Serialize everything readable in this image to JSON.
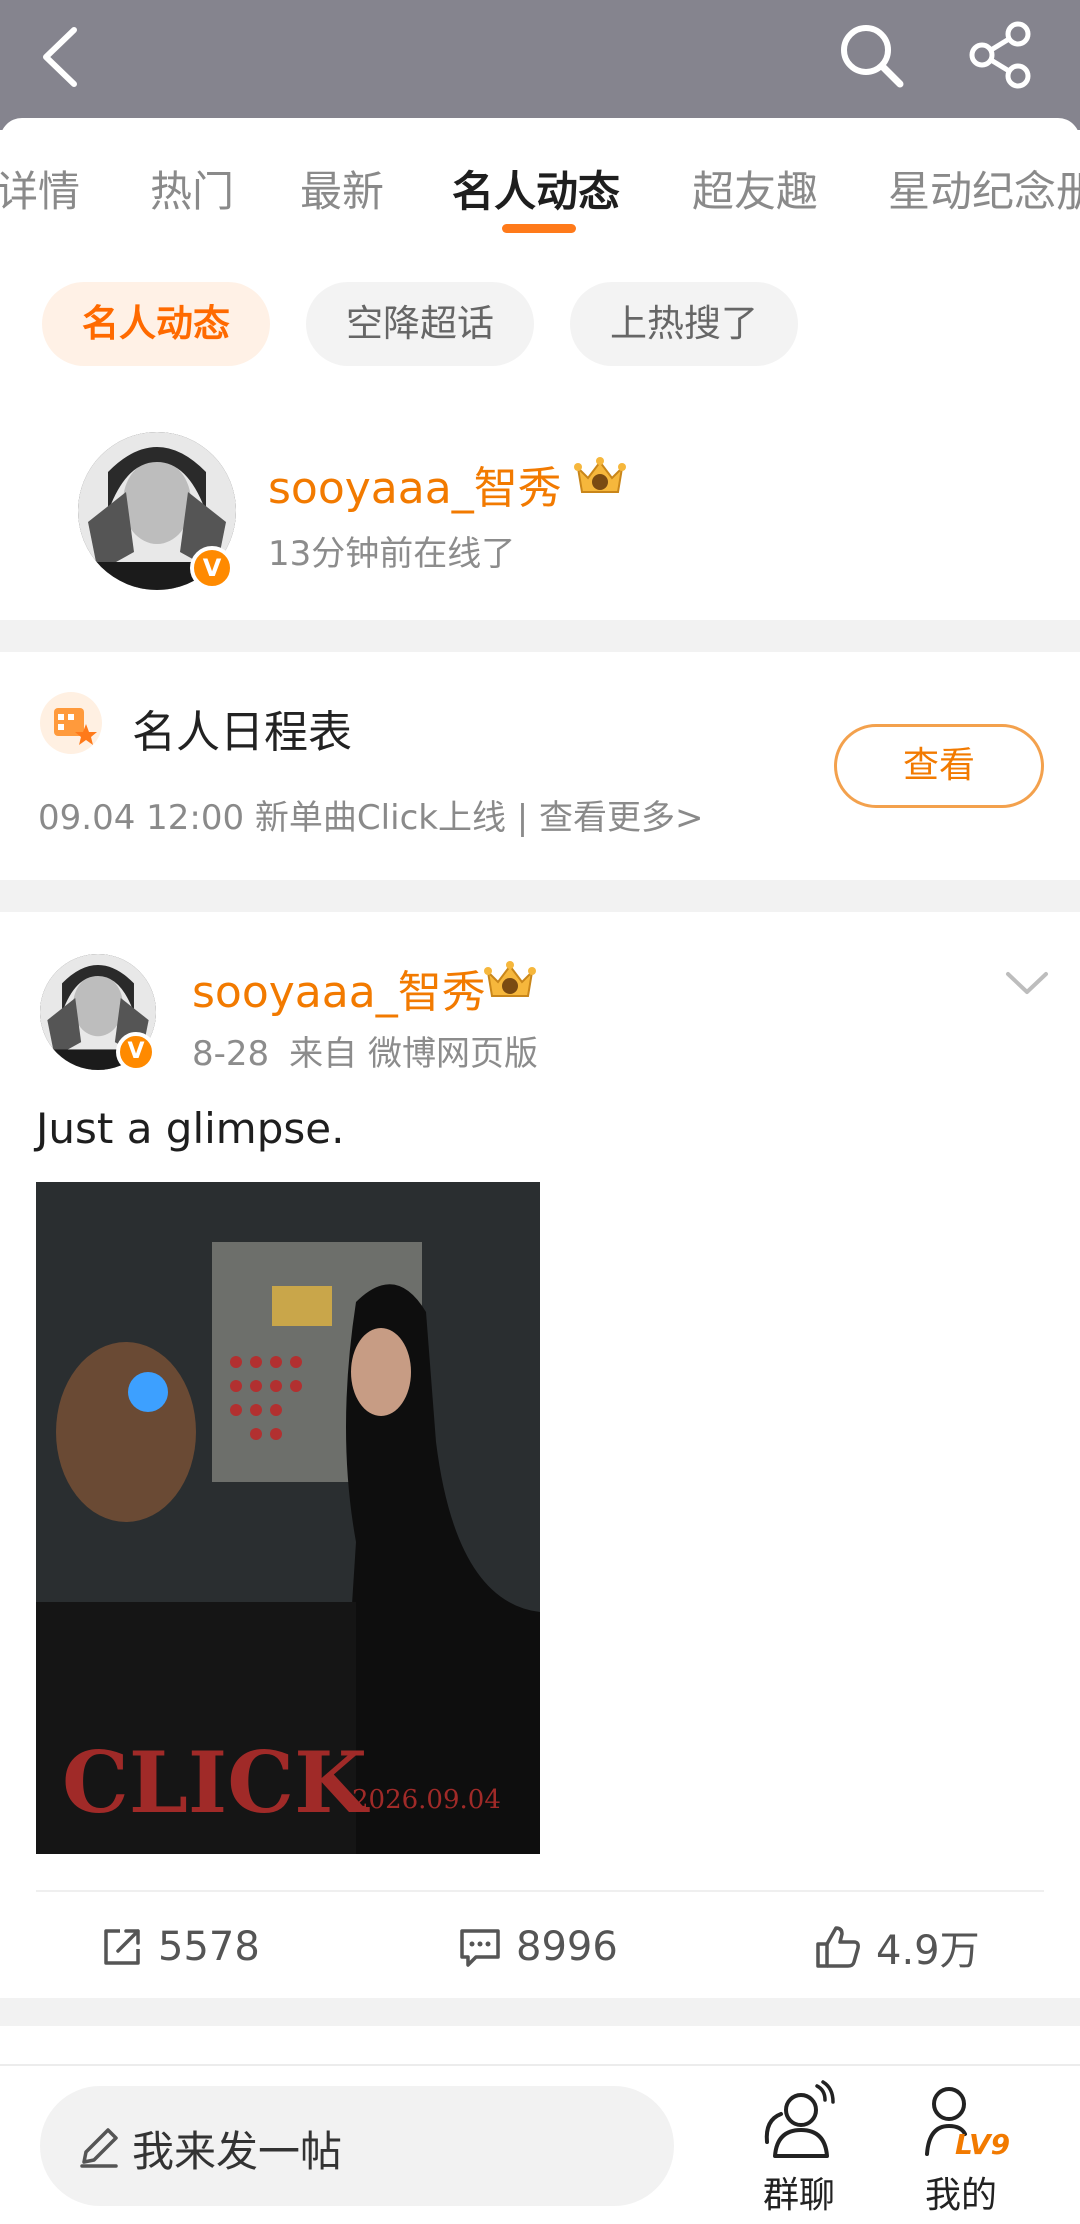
{
  "header": {
    "title": "",
    "icons": [
      "back-icon",
      "search-icon",
      "share-icon"
    ]
  },
  "tabs": [
    {
      "label": "详情"
    },
    {
      "label": "热门"
    },
    {
      "label": "最新"
    },
    {
      "label": "名人动态"
    },
    {
      "label": "超友趣"
    },
    {
      "label": "星动纪念册"
    }
  ],
  "chips": [
    {
      "label": "名人动态"
    },
    {
      "label": "空降超话"
    },
    {
      "label": "上热搜了"
    }
  ],
  "profile": {
    "name": "sooyaaa_智秀",
    "status": "13分钟前在线了",
    "verified_badge": "V"
  },
  "schedule": {
    "title": "名人日程表",
    "subtitle": "09.04 12:00 新单曲Click上线 |  查看更多>",
    "button": "查看"
  },
  "post": {
    "author": "sooyaaa_智秀",
    "date": "8-28",
    "source": "来自 微博网页版",
    "text": "Just a glimpse.",
    "image": {
      "title": "CLICK",
      "date": "2026.09.04"
    },
    "reposts": "5578",
    "comments": "8996",
    "likes": "4.9万"
  },
  "bottom": {
    "compose_placeholder": "我来发一帖",
    "group_chat": "群聊",
    "mine": "我的",
    "level": "LV9"
  },
  "colors": {
    "accent": "#f27a00",
    "topbar": "#85848e"
  }
}
